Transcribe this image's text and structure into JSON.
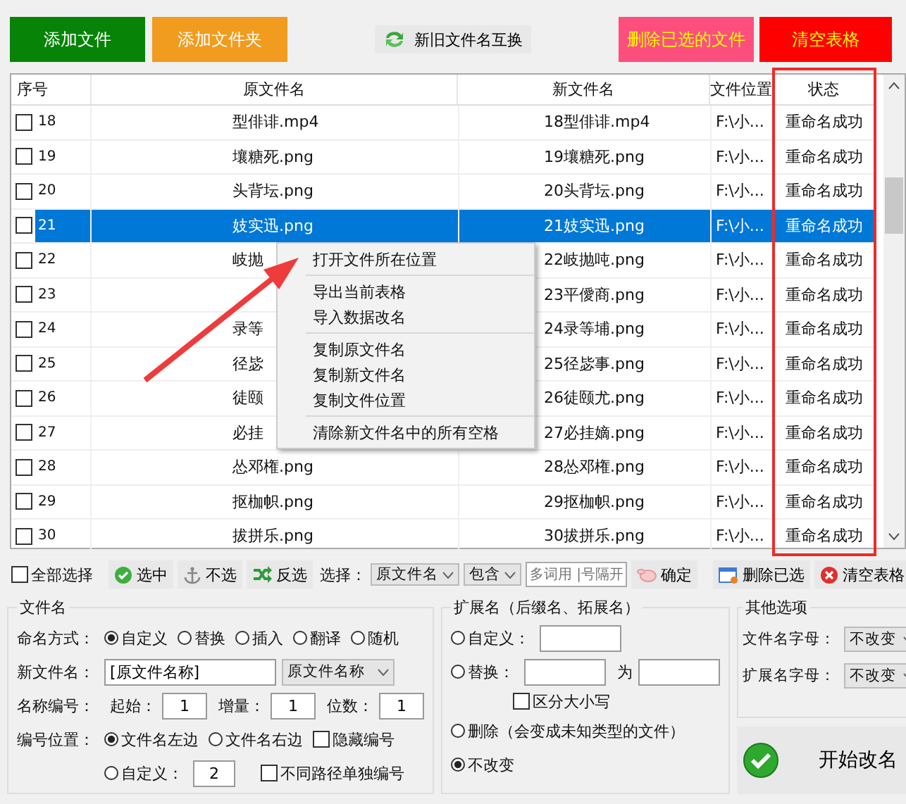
{
  "top_buttons": [
    {
      "kind": "solid",
      "label": "添加文件",
      "color": "#078307"
    },
    {
      "kind": "solid",
      "label": "添加文件夹",
      "color": "#f19c1e"
    },
    {
      "kind": "swap",
      "label": "新旧文件名互换"
    },
    {
      "kind": "alert",
      "label": "删除已选的文件",
      "color": "#fd4f7e"
    },
    {
      "kind": "alert",
      "label": "清空表格",
      "color": "#ff0000"
    }
  ],
  "table": {
    "columns": [
      "序号",
      "原文件名",
      "新文件名",
      "文件位置",
      "状态"
    ],
    "rows": [
      {
        "no": "18",
        "checked": false,
        "selected": false,
        "original": "型俳诽.mp4",
        "new": "18型俳诽.mp4",
        "location": "F:\\小...",
        "status": "重命名成功"
      },
      {
        "no": "19",
        "checked": false,
        "selected": false,
        "original": "壤糖死.png",
        "new": "19壤糖死.png",
        "location": "F:\\小...",
        "status": "重命名成功"
      },
      {
        "no": "20",
        "checked": false,
        "selected": false,
        "original": "头背坛.png",
        "new": "20头背坛.png",
        "location": "F:\\小...",
        "status": "重命名成功"
      },
      {
        "no": "21",
        "checked": false,
        "selected": true,
        "original": "妓实迅.png",
        "new": "21妓实迅.png",
        "location": "F:\\小...",
        "status": "重命名成功"
      },
      {
        "no": "22",
        "checked": false,
        "selected": false,
        "original": "岐抛",
        "new": "22岐抛吨.png",
        "location": "F:\\小...",
        "status": "重命名成功"
      },
      {
        "no": "23",
        "checked": false,
        "selected": false,
        "new": "23平僾商.png",
        "location": "F:\\小...",
        "status": "重命名成功"
      },
      {
        "no": "24",
        "checked": false,
        "selected": false,
        "original": "录等",
        "new": "24录等埔.png",
        "location": "F:\\小...",
        "status": "重命名成功"
      },
      {
        "no": "25",
        "checked": false,
        "selected": false,
        "original": "径毖",
        "new": "25径毖事.png",
        "location": "F:\\小...",
        "status": "重命名成功"
      },
      {
        "no": "26",
        "checked": false,
        "selected": false,
        "original": "徒颐",
        "new": "26徒颐尤.png",
        "location": "F:\\小...",
        "status": "重命名成功"
      },
      {
        "no": "27",
        "checked": false,
        "selected": false,
        "original": "必挂",
        "new": "27必挂嫡.png",
        "location": "F:\\小...",
        "status": "重命名成功"
      },
      {
        "no": "28",
        "checked": false,
        "selected": false,
        "original": "怂邓権.png",
        "new": "28怂邓権.png",
        "location": "F:\\小...",
        "status": "重命名成功"
      },
      {
        "no": "29",
        "checked": false,
        "selected": false,
        "original": "抠枷帜.png",
        "new": "29抠枷帜.png",
        "location": "F:\\小...",
        "status": "重命名成功"
      },
      {
        "no": "30",
        "checked": false,
        "selected": false,
        "original": "拔拼乐.png",
        "new": "30拔拼乐.png",
        "location": "F:\\小...",
        "status": "重命名成功"
      }
    ]
  },
  "context_menu": {
    "groups": [
      [
        "打开文件所在位置"
      ],
      [
        "导出当前表格",
        "导入数据改名"
      ],
      [
        "复制原文件名",
        "复制新文件名",
        "复制文件位置"
      ],
      [
        "清除新文件名中的所有空格"
      ]
    ]
  },
  "select_bar": {
    "select_all": {
      "label": "全部选择",
      "checked": false
    },
    "buttons": [
      {
        "kind": "check",
        "label": "选中"
      },
      {
        "kind": "anchor",
        "label": "不选"
      },
      {
        "kind": "invert",
        "label": "反选"
      }
    ],
    "label": "选择：",
    "column": "原文件名",
    "match": "包含",
    "placeholder": "多词用 |号隔开",
    "confirm": "确定",
    "delete": "删除已选",
    "clear": "清空表格"
  },
  "filename": {
    "title": "文件名",
    "mode_label": "命名方式：",
    "modes": [
      {
        "label": "自定义",
        "selected": true
      },
      {
        "label": "替换",
        "selected": false
      },
      {
        "label": "插入",
        "selected": false
      },
      {
        "label": "翻译",
        "selected": false
      },
      {
        "label": "随机",
        "selected": false
      }
    ],
    "new_name_label": "新文件名：",
    "new_name": "[原文件名称]",
    "new_name_option": "原文件名称",
    "number_label": "名称编号：",
    "number_fields": [
      {
        "label": "起始：",
        "value": "1"
      },
      {
        "label": "增量：",
        "value": "1"
      },
      {
        "label": "位数：",
        "value": "1"
      }
    ],
    "position_label": "编号位置：",
    "positions": [
      {
        "label": "文件名左边",
        "selected": true
      },
      {
        "label": "文件名右边",
        "selected": false
      }
    ],
    "hide": {
      "label": "隐藏编号",
      "checked": false
    },
    "custom": {
      "label": "自定义：",
      "selected": false,
      "value": "2"
    },
    "separate": {
      "label": "不同路径单独编号",
      "checked": false
    }
  },
  "extension": {
    "title": "扩展名（后缀名、拓展名）",
    "custom": {
      "label": "自定义：",
      "selected": false
    },
    "replace": {
      "label": "替换：",
      "selected": false,
      "to": "为"
    },
    "case": {
      "label": "区分大小写",
      "checked": false
    },
    "delete": {
      "label": "删除（会变成未知类型的文件）",
      "selected": false
    },
    "keep": {
      "label": "不改变",
      "selected": true
    }
  },
  "other": {
    "title": "其他选项",
    "rows": [
      {
        "label": "文件名字母：",
        "value": "不改变"
      },
      {
        "label": "扩展名字母：",
        "value": "不改变"
      }
    ]
  },
  "start": "开始改名"
}
